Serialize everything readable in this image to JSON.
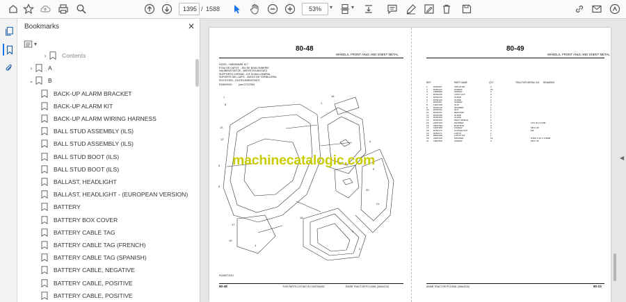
{
  "toolbar": {
    "current_page": "1395",
    "page_separator": "/",
    "total_pages": "1588",
    "zoom": "53%"
  },
  "bookmarks": {
    "title": "Bookmarks",
    "items": [
      {
        "label": "Contents",
        "level": 1,
        "chevron": "right"
      },
      {
        "label": "A",
        "level": 0,
        "chevron": "right"
      },
      {
        "label": "B",
        "level": 0,
        "chevron": "down"
      },
      {
        "label": "BACK-UP ALARM BRACKET",
        "level": 1
      },
      {
        "label": "BACK-UP ALARM KIT",
        "level": 1
      },
      {
        "label": "BACK-UP ALARM WIRING HARNESS",
        "level": 1
      },
      {
        "label": "BALL STUD ASSEMBLY (ILS)",
        "level": 1
      },
      {
        "label": "BALL STUD ASSEMBLY (ILS)",
        "level": 1
      },
      {
        "label": "BALL STUD BOOT (ILS)",
        "level": 1
      },
      {
        "label": "BALL STUD BOOT (ILS)",
        "level": 1
      },
      {
        "label": "BALLAST, HEADLIGHT",
        "level": 1
      },
      {
        "label": "BALLAST, HEADLIGHT - (EUROPEAN VERSION)",
        "level": 1
      },
      {
        "label": "BATTERY",
        "level": 1
      },
      {
        "label": "BATTERY BOX COVER",
        "level": 1
      },
      {
        "label": "BATTERY CABLE TAG",
        "level": 1
      },
      {
        "label": "BATTERY CABLE TAG (FRENCH)",
        "level": 1
      },
      {
        "label": "BATTERY CABLE TAG (SPANISH)",
        "level": 1
      },
      {
        "label": "BATTERY CABLE, NEGATIVE",
        "level": 1
      },
      {
        "label": "BATTERY CABLE, POSITIVE",
        "level": 1
      },
      {
        "label": "BATTERY CABLE, POSITIVE",
        "level": 1
      }
    ]
  },
  "document": {
    "left_page": {
      "page_number": "80-48",
      "section": "WHEELS, FRONT AXLE AND SHEET METAL",
      "title_lines": [
        "HOOD - HARDWARE KIT",
        "ETAU DE CAPOT - JEU DE BOULONNERIE",
        "HAUBENSTUETZE - BEFESTIGUNGSATZ",
        "SUPPORTO COFANO - KIT DI BULLONERIA",
        "SOPORTE DEL CAPO - JUEGO DE TORNILLERIA",
        "ROYSTOED - FASTELEMENTSATS"
      ],
      "ref_left": "R348/09X01",
      "ref_right": "(see DTC5780)",
      "figure_id": "RS45/07X001",
      "footer_left": "80-48",
      "footer_center": "THIS PARTS LISTING IS CONTINUED",
      "footer_right": "8345R TRACTOR   PC10081   (30AUG10)"
    },
    "right_page": {
      "page_number": "80-49",
      "section": "WHEELS, FRONT AXLE AND SHEET METAL",
      "columns": [
        "REF",
        "PART NAME",
        "QTY",
        "TRACTOR SERIAL NO.",
        "REMARKS"
      ],
      "rows": [
        {
          "ref": "1",
          "part": "R252115",
          "name": "ISOLATOR",
          "qty": "2",
          "remark": ""
        },
        {
          "ref": "2",
          "part": "R252122",
          "name": "SCREW",
          "qty": "20",
          "remark": ""
        },
        {
          "ref": "3",
          "part": "19M8400",
          "name": "SCREW",
          "qty": "2",
          "remark": ""
        },
        {
          "ref": "4",
          "part": "R252126",
          "name": "LOCK NUT",
          "qty": "2",
          "remark": ""
        },
        {
          "ref": "5",
          "part": "R252130",
          "name": "GUIDE",
          "qty": "2",
          "remark": ""
        },
        {
          "ref": "6",
          "part": "R252140",
          "name": "GUIDE",
          "qty": "1",
          "remark": ""
        },
        {
          "ref": "7",
          "part": "R251357",
          "name": "SCREW",
          "qty": "1",
          "remark": ""
        },
        {
          "ref": "8",
          "part": "19M7436",
          "name": "CLIP",
          "qty": "4",
          "remark": ""
        },
        {
          "ref": "9",
          "part": "R252149",
          "name": "WASHER",
          "qty": "1",
          "remark": ""
        },
        {
          "ref": "10",
          "part": "R252156",
          "name": "NUT",
          "qty": "1",
          "remark": ""
        },
        {
          "ref": "11",
          "part": "R252157",
          "name": "BRACKET",
          "qty": "1",
          "remark": ""
        },
        {
          "ref": "12",
          "part": "R252158",
          "name": "GUIDE",
          "qty": "1",
          "remark": ""
        },
        {
          "ref": "13",
          "part": "R252159",
          "name": "GUIDE",
          "qty": "1",
          "remark": ""
        },
        {
          "ref": "14",
          "part": "R252160",
          "name": "HEAT SHIELD",
          "qty": "1",
          "remark": ""
        },
        {
          "ref": "15",
          "part": "24M7163",
          "name": "WASHER",
          "qty": "4",
          "remark": "13.5 ID X 5 MM"
        },
        {
          "ref": "16",
          "part": "24M7043",
          "name": "BUSHING",
          "qty": "2",
          "remark": ""
        },
        {
          "ref": "17",
          "part": "14M7296",
          "name": "SCREW",
          "qty": "4",
          "remark": "M8 X 25"
        },
        {
          "ref": "18",
          "part": "R252170",
          "name": "FLANGE NUT",
          "qty": "2",
          "remark": "M8"
        },
        {
          "ref": "19",
          "part": "R252171",
          "name": "LATCH",
          "qty": "1",
          "remark": ""
        },
        {
          "ref": "19",
          "part": "RE51420",
          "name": "LATCH KIT",
          "qty": "1",
          "remark": ""
        },
        {
          "ref": "20",
          "part": "24M7120",
          "name": "WASHER",
          "qty": "14",
          "remark": "8.600 X 22 X 2.5MM"
        },
        {
          "ref": "21",
          "part": "19M7876",
          "name": "SCREW",
          "qty": "2",
          "remark": "M8 X 40"
        }
      ],
      "footer_left": "8345R TRACTOR   PC10081   (30AUG10)",
      "footer_right": "80-23"
    },
    "watermark": "machinecatalogic.com"
  }
}
